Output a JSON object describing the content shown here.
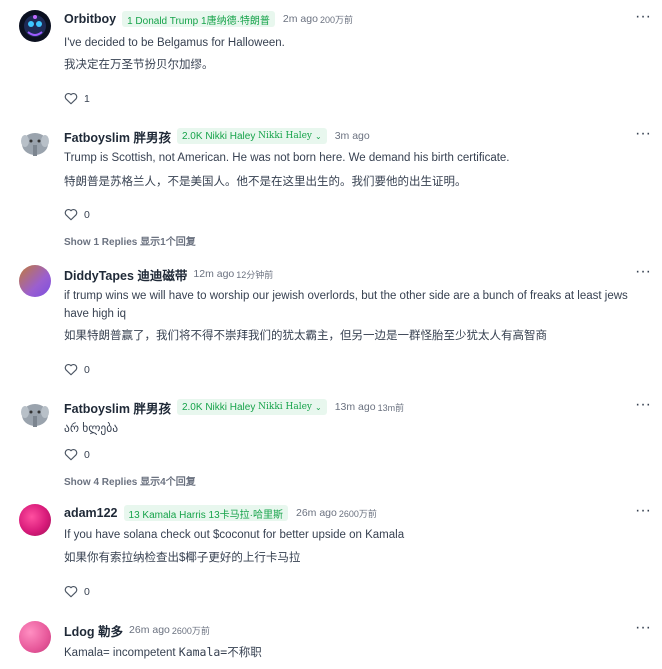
{
  "comments": [
    {
      "username": "Orbitboy",
      "badge": "1 Donald Trump 1唐纳德·特朗普",
      "time": "2m ago",
      "time_ext": "200万前",
      "text": "I've decided to be Belgamus for Halloween.",
      "translation": "我决定在万圣节扮贝尔加缪。",
      "likes": "1"
    },
    {
      "username": "Fatboyslim 胖男孩",
      "badge": "2.0K Nikki Haley",
      "badge_ext": "Nikki Haley",
      "time": "3m ago",
      "text": "Trump is Scottish, not American. He was not born here. We demand his birth certificate.",
      "translation": "特朗普是苏格兰人，不是美国人。他不是在这里出生的。我们要他的出生证明。",
      "likes": "0",
      "replies": "Show 1 Replies 显示1个回复"
    },
    {
      "username": "DiddyTapes 迪迪磁带",
      "time": "12m ago",
      "time_ext": "12分钟前",
      "text": "if trump wins we will have to worship our jewish overlords, but the other side are a bunch of freaks at least jews have high iq",
      "translation": "如果特朗普赢了，我们将不得不崇拜我们的犹太霸主，但另一边是一群怪胎至少犹太人有高智商",
      "likes": "0"
    },
    {
      "username": "Fatboyslim 胖男孩",
      "badge": "2.0K Nikki Haley",
      "badge_ext": "Nikki Haley",
      "time": "13m ago",
      "time_ext": "13m前",
      "text": "არ ხლება",
      "likes": "0",
      "replies": "Show 4 Replies 显示4个回复"
    },
    {
      "username": "adam122",
      "badge": "13 Kamala Harris 13卡马拉·哈里斯",
      "time": "26m ago",
      "time_ext": "2600万前",
      "text": "If you have solana check out $coconut for better upside on Kamala",
      "translation": "如果你有索拉纳检查出$椰子更好的上行卡马拉",
      "likes": "0"
    },
    {
      "username": "Ldog 勒多",
      "time": "26m ago",
      "time_ext": "2600万前",
      "text_a": "Kamala= incompetent",
      "text_b": "Kamala=不称职"
    }
  ],
  "icons": {
    "like": "heart-icon",
    "more": "more-options-icon"
  },
  "colors": {
    "badge_bg": "#e8f7ee",
    "badge_fg": "#16a34a"
  }
}
